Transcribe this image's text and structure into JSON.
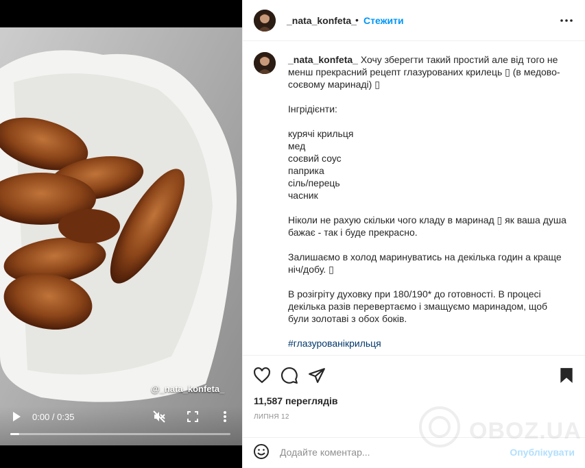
{
  "video": {
    "overlay_handle": "@_nata_konfeta_",
    "time": "0:00 / 0:35",
    "progress_fraction": 0.0
  },
  "header": {
    "username": "_nata_konfeta_",
    "separator": "•",
    "follow_label": "Стежити"
  },
  "caption": {
    "username": "_nata_konfeta_",
    "intro": " Хочу зберегти такий простий але від того не менш прекрасний рецепт глазурованих крилець ▯ (в медово-соєвому маринаді) ▯",
    "ingredients_title": "Інгрідієнти:",
    "ingredients": [
      "курячі крильця",
      "мед",
      "соєвий соус",
      "паприка",
      "сіль/перець",
      "часник"
    ],
    "para1": "Ніколи не рахую скільки чого кладу в маринад ▯ як ваша душа бажає - так і буде прекрасно.",
    "para2": "Залишаємо в холод маринуватись на декілька годин а краще ніч/добу. ▯",
    "para3": "В розігріту духовку при 180/190* до готовності. В процесі декілька разів перевертаємо і змащуємо маринадом, щоб були золотаві з обох боків.",
    "hashtag": "#глазурованікрильця"
  },
  "stats": {
    "views": "11,587 переглядів",
    "date": "ЛИПНЯ 12"
  },
  "comment": {
    "placeholder": "Додайте коментар...",
    "publish_label": "Опублікувати"
  },
  "watermark": {
    "text": "OBOZ.UA"
  },
  "colors": {
    "accent": "#0095f6",
    "publish_disabled": "#b2dffc",
    "hashtag": "#00376b",
    "muted": "#8e8e8e"
  },
  "icons": [
    "play-icon",
    "mute-icon",
    "fullscreen-icon",
    "more-vertical-icon",
    "more-horizontal-icon",
    "heart-icon",
    "comment-icon",
    "share-icon",
    "bookmark-icon",
    "emoji-icon"
  ]
}
